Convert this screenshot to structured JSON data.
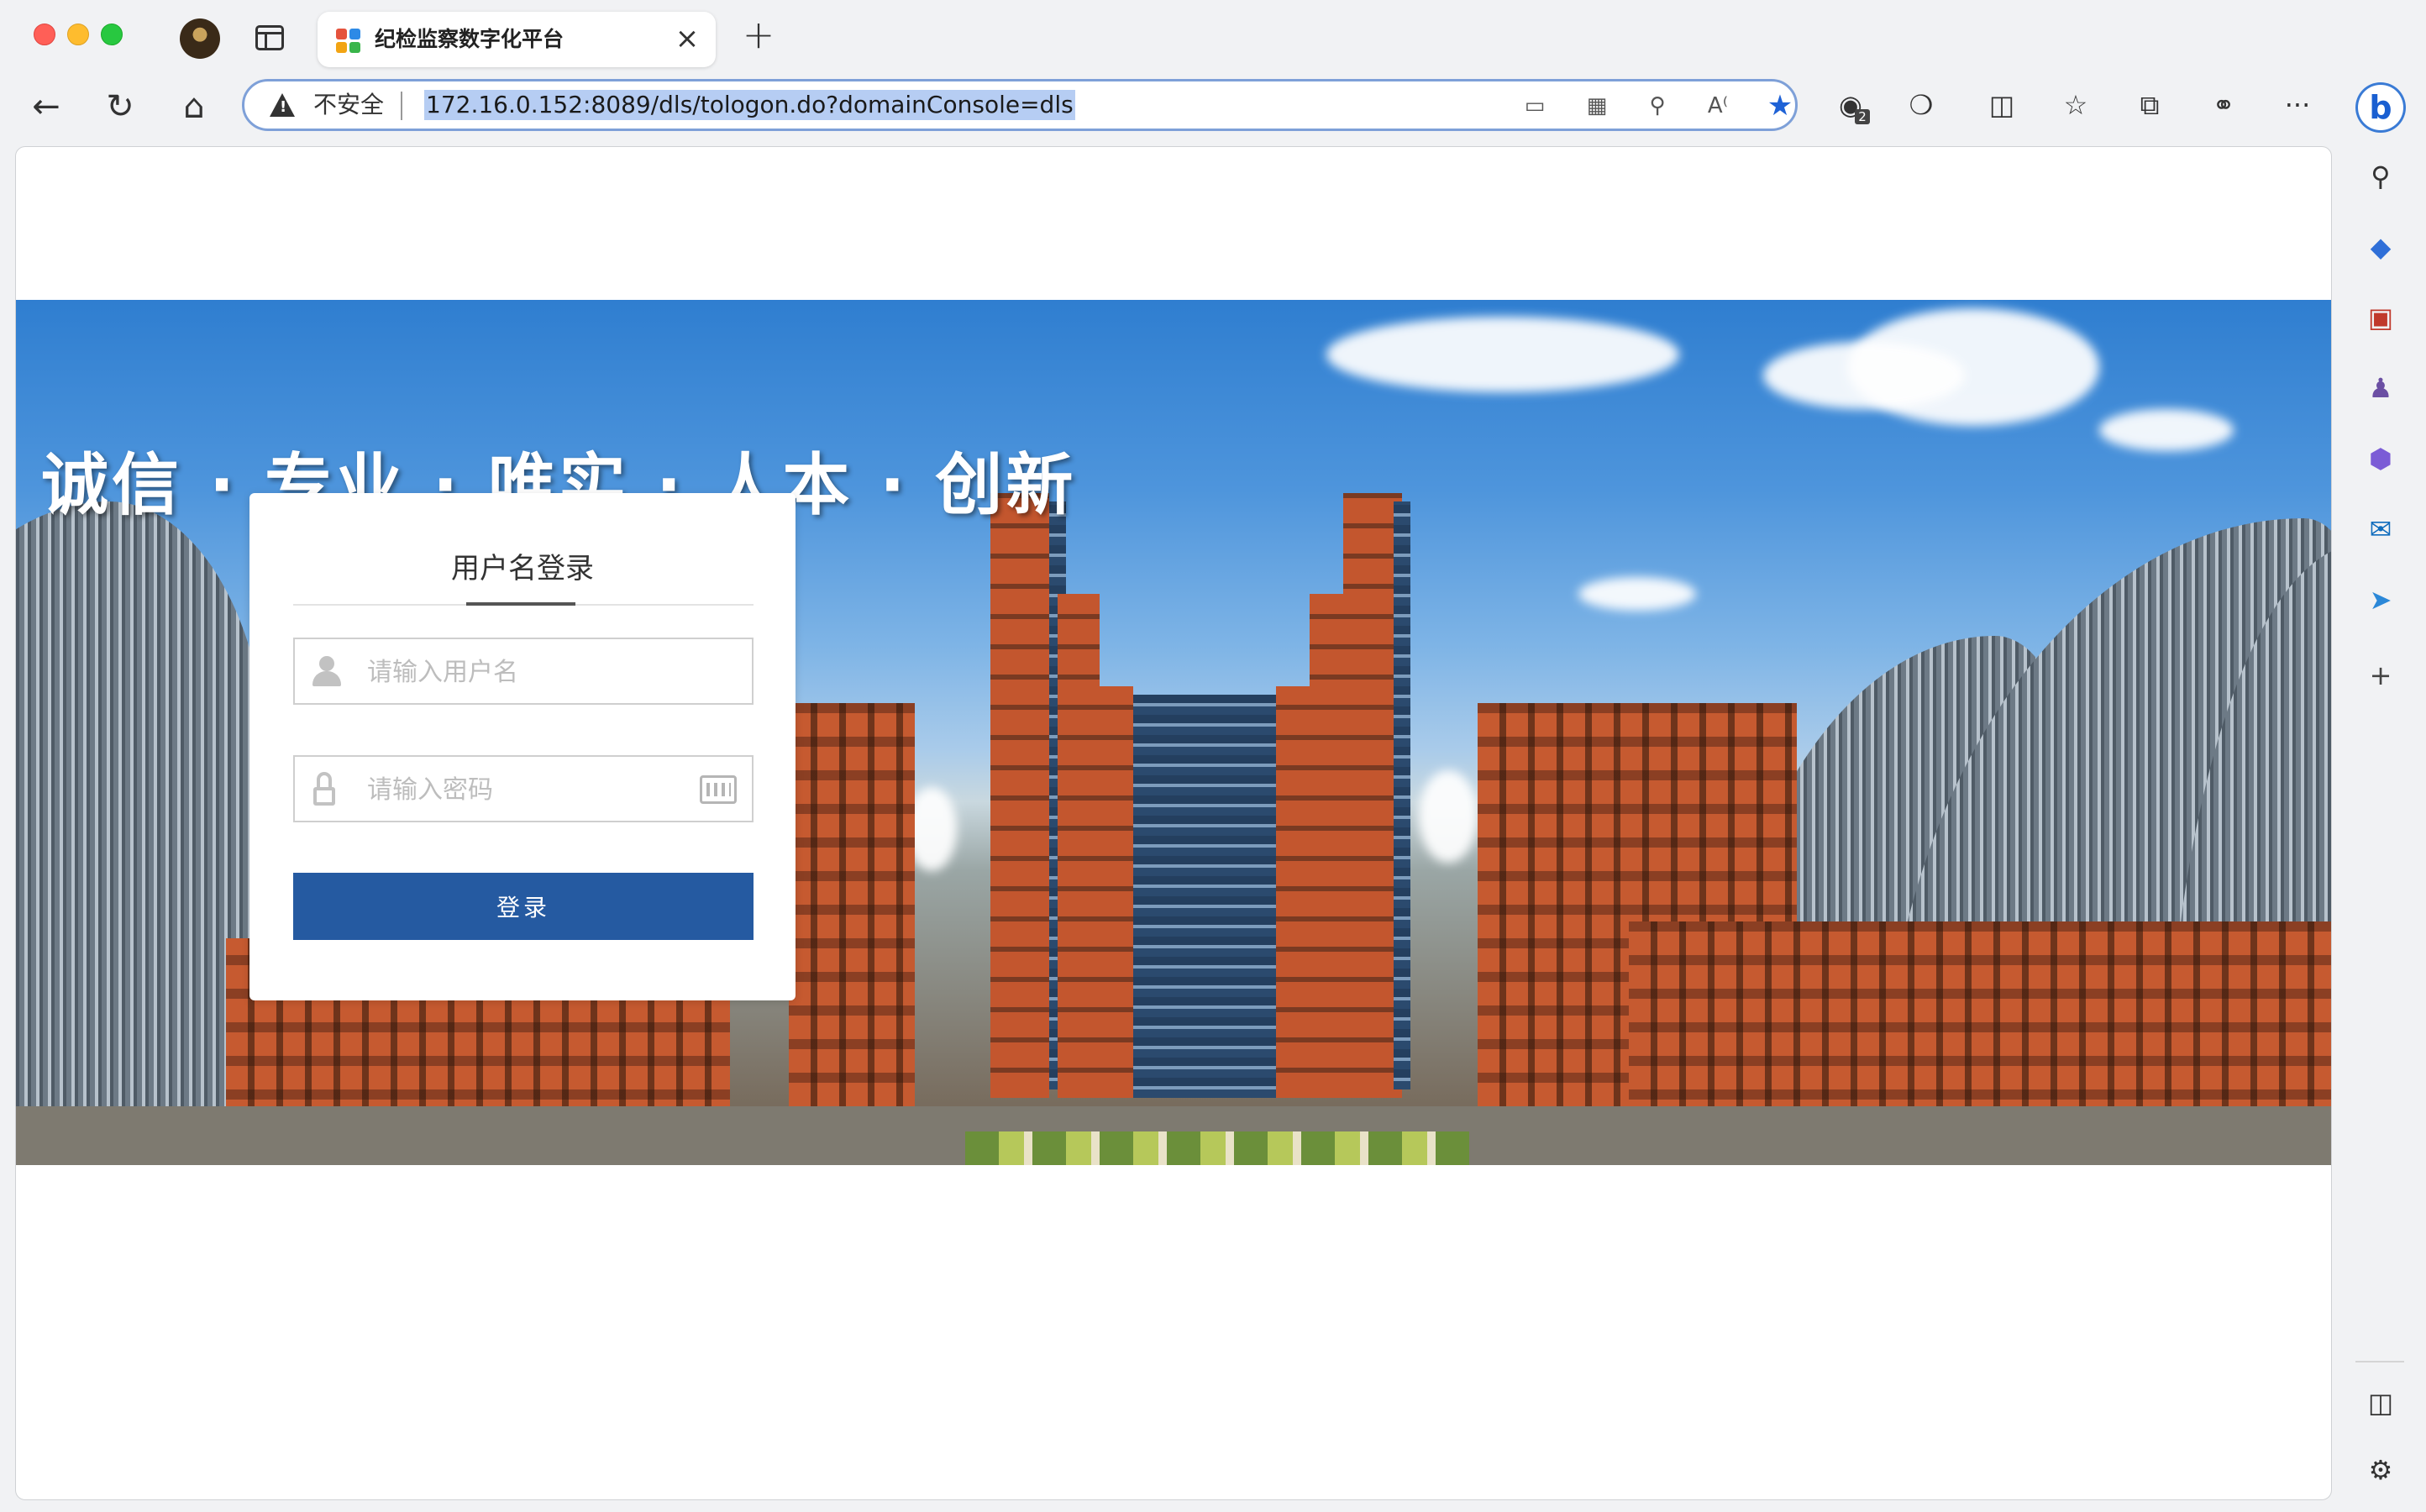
{
  "browser": {
    "tab": {
      "title": "纪检监察数字化平台",
      "close_glyph": "×"
    },
    "new_tab_glyph": "+",
    "address_bar": {
      "security_label": "不安全",
      "url": "172.16.0.152:8089/dls/tologon.do?domainConsole=dls"
    },
    "extensions_badge_count": "2",
    "more_glyph": "···",
    "bing_glyph": "b"
  },
  "page": {
    "slogan": "诚信 · 专业 · 唯实 · 人本 · 创新",
    "login": {
      "title": "用户名登录",
      "username_placeholder": "请输入用户名",
      "password_placeholder": "请输入密码",
      "submit_label": "登录"
    }
  },
  "sidebar": {
    "add_glyph": "+"
  },
  "colors": {
    "primary_button": "#255aa1",
    "url_highlight": "#b6cdf3",
    "favorite_star": "#1f62d6"
  }
}
